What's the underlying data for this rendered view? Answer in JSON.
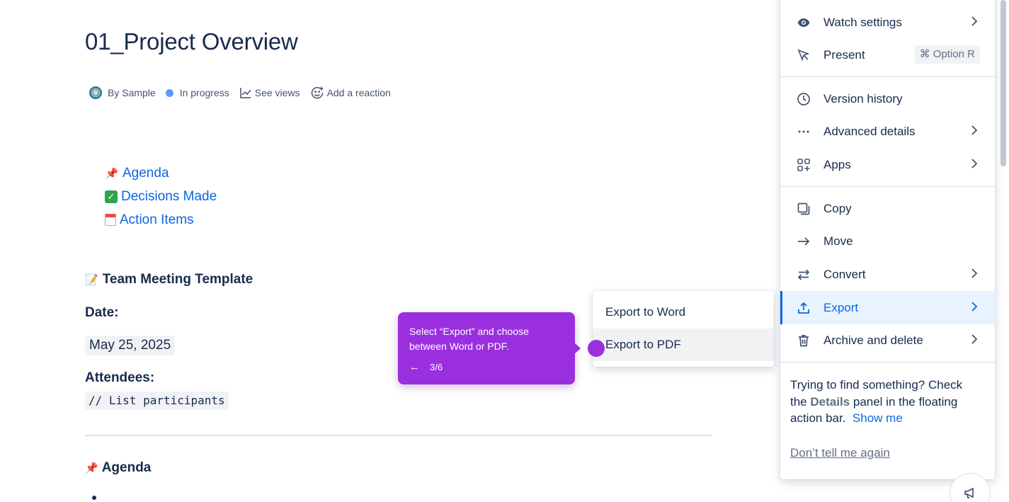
{
  "page": {
    "title": "01_Project Overview",
    "byline": {
      "author": "By Sample",
      "status": "In progress",
      "views": "See views",
      "reaction": "Add a reaction"
    },
    "toc": [
      {
        "emoji": "pin",
        "label": "Agenda"
      },
      {
        "emoji": "check",
        "label": "Decisions Made"
      },
      {
        "emoji": "calendar",
        "label": "Action Items"
      }
    ],
    "team_heading": "Team Meeting Template",
    "date_label": "Date:",
    "date_value": "May 25, 2025",
    "attendees_label": "Attendees:",
    "attendees_code": "// List participants",
    "agenda_heading": "Agenda"
  },
  "tour": {
    "text": "Select “Export” and choose between Word or PDF.",
    "back": "←",
    "step": "3/6",
    "accent": "#9a2fe0"
  },
  "export_submenu": {
    "items": [
      "Export to Word",
      "Export to PDF"
    ],
    "hovered": "Export to PDF"
  },
  "menu": {
    "items": [
      {
        "icon": "eye-icon",
        "label": "Watch settings",
        "chevron": true
      },
      {
        "icon": "present-icon",
        "label": "Present",
        "shortcut": "⌘ Option R"
      },
      {
        "icon": "clock-icon",
        "label": "Version history"
      },
      {
        "icon": "more-icon",
        "label": "Advanced details",
        "chevron": true
      },
      {
        "icon": "apps-icon",
        "label": "Apps",
        "chevron": true
      },
      {
        "icon": "copy-icon",
        "label": "Copy"
      },
      {
        "icon": "arrow-right-icon",
        "label": "Move"
      },
      {
        "icon": "convert-icon",
        "label": "Convert",
        "chevron": true
      },
      {
        "icon": "export-icon",
        "label": "Export",
        "chevron": true,
        "active": true
      },
      {
        "icon": "trash-icon",
        "label": "Archive and delete",
        "chevron": true
      }
    ],
    "help_text_1": "Trying to find something? Check the",
    "help_bold": "Details",
    "help_text_2": "panel in the floating action bar.",
    "help_link": "Show me",
    "dont_tell": "Don’t tell me again",
    "accent": "#0c66e4"
  }
}
